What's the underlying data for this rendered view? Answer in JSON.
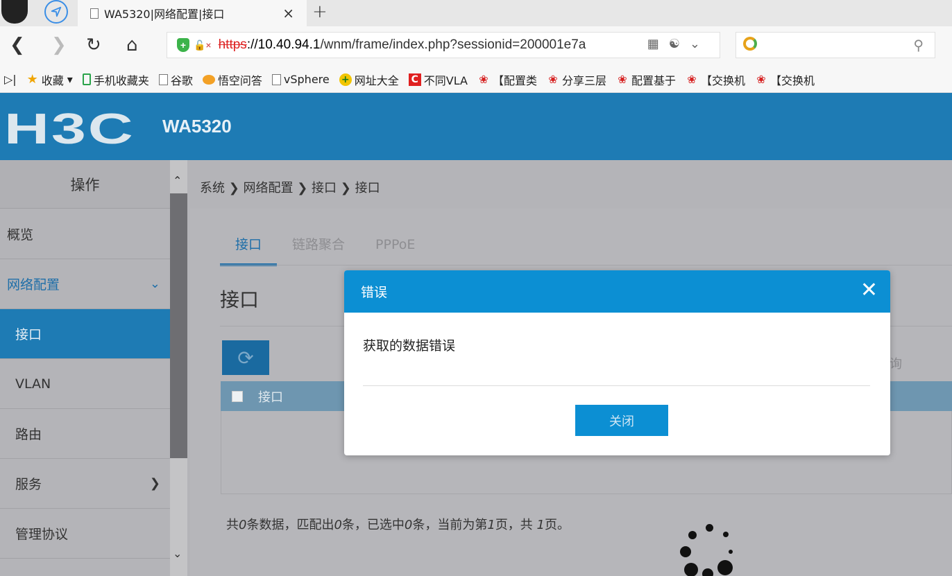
{
  "browser": {
    "tab_title": "WA5320|网络配置|接口",
    "tab_close": "×",
    "new_tab": "+",
    "url_scheme": "https",
    "url_host": "://10.40.94.1",
    "url_path": "/wnm/frame/index.php?sessionid=200001e7a",
    "bookmarks": [
      {
        "label": "收藏",
        "icon": "star-icon"
      },
      {
        "label": "手机收藏夹",
        "icon": "phone-icon"
      },
      {
        "label": "谷歌",
        "icon": "doc-icon"
      },
      {
        "label": "悟空问答",
        "icon": "owl-icon"
      },
      {
        "label": "vSphere",
        "icon": "doc-icon"
      },
      {
        "label": "网址大全",
        "icon": "green-plus-icon"
      },
      {
        "label": "不同VLA",
        "icon": "red-c-icon"
      },
      {
        "label": "【配置类",
        "icon": "huawei-icon"
      },
      {
        "label": "分享三层",
        "icon": "huawei-icon"
      },
      {
        "label": "配置基于",
        "icon": "huawei-icon"
      },
      {
        "label": "【交换机",
        "icon": "huawei-icon"
      },
      {
        "label": "【交换机",
        "icon": "huawei-icon"
      }
    ]
  },
  "header": {
    "logo": "H3C",
    "model": "WA5320"
  },
  "sidebar": {
    "title": "操作",
    "items": [
      {
        "label": "概览"
      },
      {
        "label": "网络配置"
      },
      {
        "label": "接口"
      },
      {
        "label": "VLAN"
      },
      {
        "label": "路由"
      },
      {
        "label": "服务"
      },
      {
        "label": "管理协议"
      }
    ]
  },
  "main": {
    "breadcrumb": "系统 ❯ 网络配置 ❯ 接口 ❯ 接口",
    "tabs": [
      {
        "label": "接口"
      },
      {
        "label": "链路聚合"
      },
      {
        "label": "PPPoE"
      }
    ],
    "heading": "接口",
    "query_partial": "询",
    "table_header": "接口",
    "summary": {
      "a": "共",
      "total": "0",
      "b": "条数据，匹配出",
      "matched": "0",
      "c": "条，已选中",
      "selected": "0",
      "d": "条，当前为第",
      "page": "1",
      "e": "页，共 ",
      "pages": "1",
      "f": "页。"
    }
  },
  "modal": {
    "title": "错误",
    "close_icon": "✕",
    "message": "获取的数据错误",
    "button": "关闭"
  },
  "colors": {
    "brand": "#1e7bb4",
    "modal_header": "#0c8fd3",
    "overlay_gray": "#b4b4b8"
  }
}
